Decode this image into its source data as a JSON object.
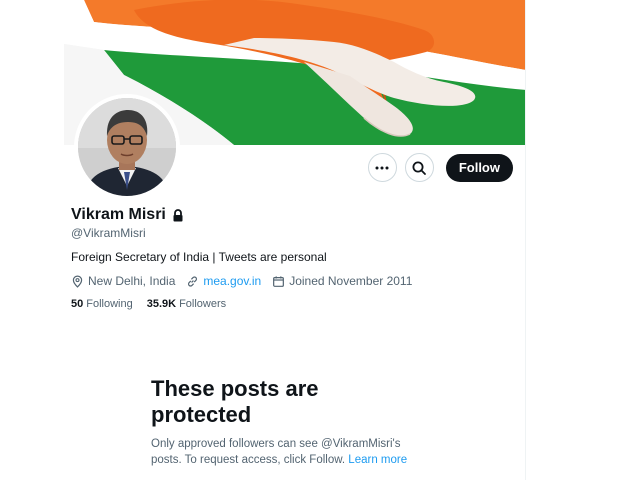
{
  "profile": {
    "display_name": "Vikram Misri",
    "handle": "@VikramMisri",
    "bio": "Foreign Secretary of India | Tweets are personal",
    "location": "New Delhi, India",
    "website": "mea.gov.in",
    "joined": "Joined November 2011",
    "following_count": "50",
    "following_label": "Following",
    "followers_count": "35.9K",
    "followers_label": "Followers",
    "protected": true
  },
  "actions": {
    "more_icon": "ellipsis-icon",
    "search_icon": "search-icon",
    "follow_label": "Follow"
  },
  "protected_notice": {
    "title_line1": "These posts are",
    "title_line2": "protected",
    "desc_line1": "Only approved followers can see @VikramMisri's",
    "desc_line2": "posts. To request access, click Follow.",
    "learn_more": "Learn more"
  },
  "colors": {
    "accent": "#1d9bf0",
    "text_primary": "#0f1419",
    "text_secondary": "#536471",
    "follow_button_bg": "#0f1419",
    "banner_saffron": "#f26b1d",
    "banner_green": "#1f9a3a"
  }
}
